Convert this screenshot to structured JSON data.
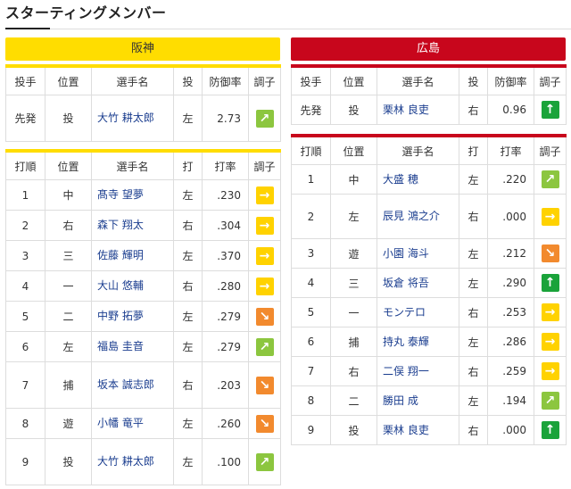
{
  "title": "スターティングメンバー",
  "home": {
    "name": "阪神",
    "pitcher_headers": [
      "投手",
      "位置",
      "選手名",
      "投",
      "防御率",
      "調子"
    ],
    "pitcher": {
      "role": "先発",
      "pos": "投",
      "name": "大竹 耕太郎",
      "hand": "左",
      "era": "2.73",
      "form": "ne"
    },
    "batting_headers": [
      "打順",
      "位置",
      "選手名",
      "打",
      "打率",
      "調子"
    ],
    "batters": [
      {
        "order": "1",
        "pos": "中",
        "name": "髙寺 望夢",
        "hand": "左",
        "avg": ".230",
        "form": "rt"
      },
      {
        "order": "2",
        "pos": "右",
        "name": "森下 翔太",
        "hand": "右",
        "avg": ".304",
        "form": "rt"
      },
      {
        "order": "3",
        "pos": "三",
        "name": "佐藤 輝明",
        "hand": "左",
        "avg": ".370",
        "form": "rt"
      },
      {
        "order": "4",
        "pos": "一",
        "name": "大山 悠輔",
        "hand": "右",
        "avg": ".280",
        "form": "rt"
      },
      {
        "order": "5",
        "pos": "二",
        "name": "中野 拓夢",
        "hand": "左",
        "avg": ".279",
        "form": "se"
      },
      {
        "order": "6",
        "pos": "左",
        "name": "福島 圭音",
        "hand": "左",
        "avg": ".279",
        "form": "ne"
      },
      {
        "order": "7",
        "pos": "捕",
        "name": "坂本 誠志郎",
        "hand": "右",
        "avg": ".203",
        "form": "se"
      },
      {
        "order": "8",
        "pos": "遊",
        "name": "小幡 竜平",
        "hand": "左",
        "avg": ".260",
        "form": "se"
      },
      {
        "order": "9",
        "pos": "投",
        "name": "大竹 耕太郎",
        "hand": "左",
        "avg": ".100",
        "form": "ne"
      }
    ]
  },
  "away": {
    "name": "広島",
    "pitcher_headers": [
      "投手",
      "位置",
      "選手名",
      "投",
      "防御率",
      "調子"
    ],
    "pitcher": {
      "role": "先発",
      "pos": "投",
      "name": "栗林 良吏",
      "hand": "右",
      "era": "0.96",
      "form": "up"
    },
    "batting_headers": [
      "打順",
      "位置",
      "選手名",
      "打",
      "打率",
      "調子"
    ],
    "batters": [
      {
        "order": "1",
        "pos": "中",
        "name": "大盛 穂",
        "hand": "左",
        "avg": ".220",
        "form": "ne"
      },
      {
        "order": "2",
        "pos": "左",
        "name": "辰見 鴻之介",
        "hand": "右",
        "avg": ".000",
        "form": "rt"
      },
      {
        "order": "3",
        "pos": "遊",
        "name": "小園 海斗",
        "hand": "左",
        "avg": ".212",
        "form": "se"
      },
      {
        "order": "4",
        "pos": "三",
        "name": "坂倉 将吾",
        "hand": "左",
        "avg": ".290",
        "form": "up"
      },
      {
        "order": "5",
        "pos": "一",
        "name": "モンテロ",
        "hand": "右",
        "avg": ".253",
        "form": "rt"
      },
      {
        "order": "6",
        "pos": "捕",
        "name": "持丸 泰輝",
        "hand": "左",
        "avg": ".286",
        "form": "rt"
      },
      {
        "order": "7",
        "pos": "右",
        "name": "二俣 翔一",
        "hand": "右",
        "avg": ".259",
        "form": "rt"
      },
      {
        "order": "8",
        "pos": "二",
        "name": "勝田 成",
        "hand": "左",
        "avg": ".194",
        "form": "ne"
      },
      {
        "order": "9",
        "pos": "投",
        "name": "栗林 良吏",
        "hand": "右",
        "avg": ".000",
        "form": "up"
      }
    ]
  },
  "icons": {
    "up": {
      "name": "arrow-up-icon",
      "glyph": "↑",
      "color": "#1aa33a"
    },
    "ne": {
      "name": "arrow-up-right-icon",
      "glyph": "↗",
      "color": "#8cc63f"
    },
    "rt": {
      "name": "arrow-right-icon",
      "glyph": "→",
      "color": "#ffd200"
    },
    "se": {
      "name": "arrow-down-right-icon",
      "glyph": "↘",
      "color": "#f28a2e"
    }
  }
}
